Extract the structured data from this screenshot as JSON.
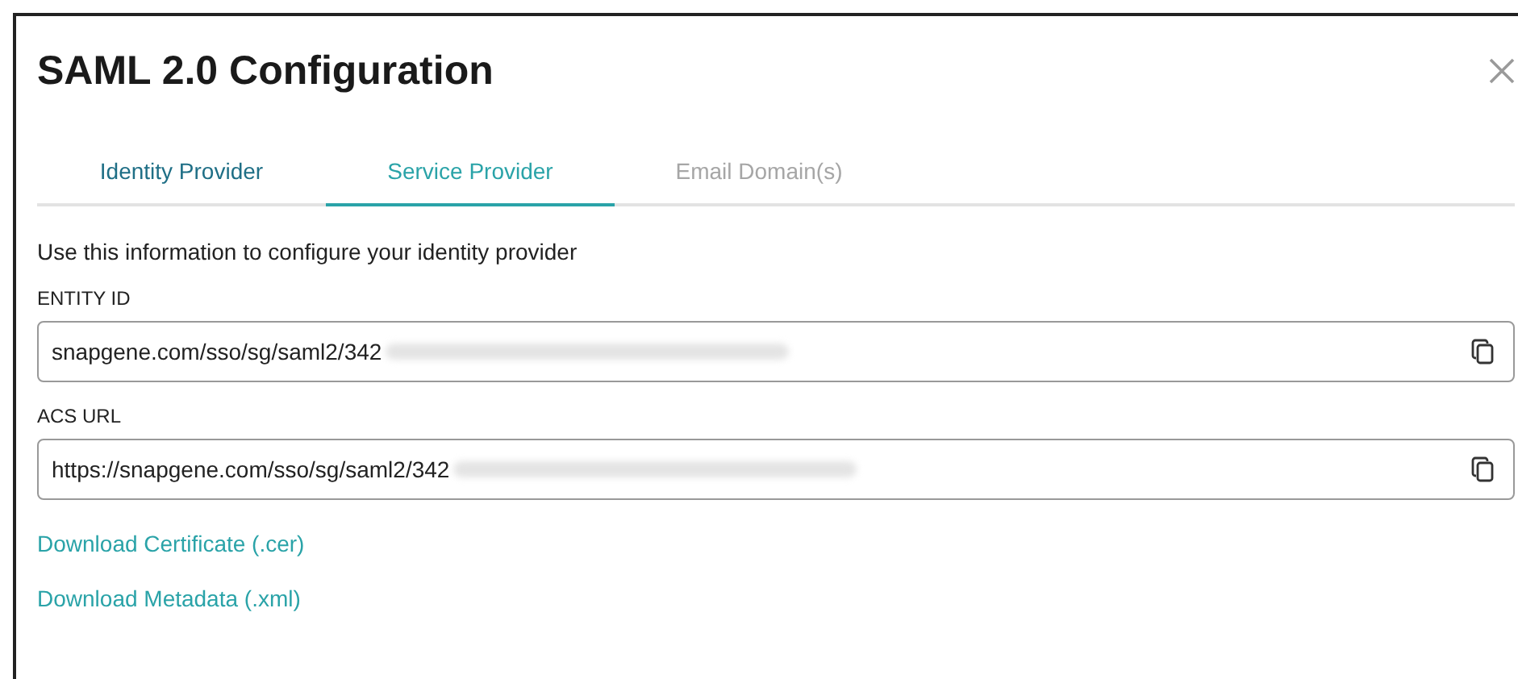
{
  "dialog": {
    "title": "SAML 2.0 Configuration"
  },
  "tabs": [
    {
      "label": "Identity Provider",
      "selected": false,
      "disabled": false
    },
    {
      "label": "Service Provider",
      "selected": true,
      "disabled": false
    },
    {
      "label": "Email Domain(s)",
      "selected": false,
      "disabled": true
    }
  ],
  "intro": "Use this information to configure your identity provider",
  "fields": [
    {
      "label": "ENTITY ID",
      "value": "snapgene.com/sso/sg/saml2/342",
      "redacted": true
    },
    {
      "label": "ACS URL",
      "value": "https://snapgene.com/sso/sg/saml2/342",
      "redacted": true
    }
  ],
  "links": [
    "Download Certificate (.cer)",
    "Download Metadata (.xml)"
  ]
}
